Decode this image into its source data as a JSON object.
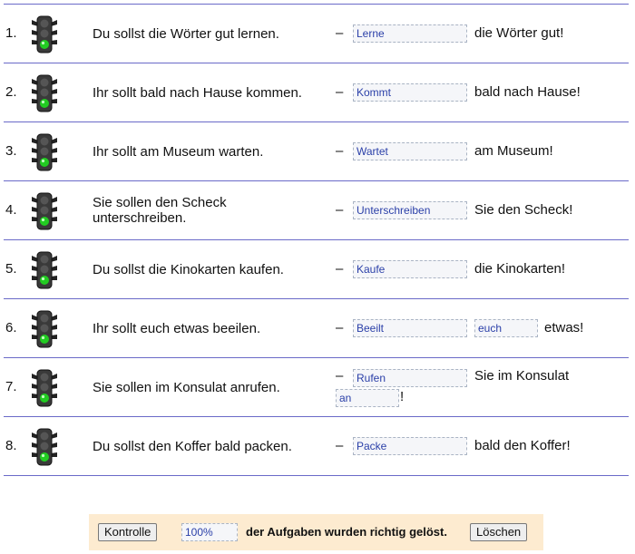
{
  "exercise": {
    "rows": [
      {
        "number": "1.",
        "prompt": "Du sollst die Wörter gut lernen.",
        "dash": "–",
        "answer1": "Lerne",
        "after1": "die Wörter gut!"
      },
      {
        "number": "2.",
        "prompt": "Ihr sollt bald nach Hause kommen.",
        "dash": "–",
        "answer1": "Kommt",
        "after1": "bald nach Hause!"
      },
      {
        "number": "3.",
        "prompt": "Ihr sollt am Museum warten.",
        "dash": "–",
        "answer1": "Wartet",
        "after1": "am Museum!"
      },
      {
        "number": "4.",
        "prompt": "Sie sollen den Scheck unterschreiben.",
        "dash": "–",
        "answer1": "Unterschreiben",
        "after1": "Sie den Scheck!"
      },
      {
        "number": "5.",
        "prompt": "Du sollst die Kinokarten kaufen.",
        "dash": "–",
        "answer1": "Kaufe",
        "after1": "die Kinokarten!"
      },
      {
        "number": "6.",
        "prompt": "Ihr sollt euch etwas beeilen.",
        "dash": "–",
        "answer1": "Beeilt",
        "answer2": "euch",
        "after2": "etwas!"
      },
      {
        "number": "7.",
        "prompt": "Sie sollen im Konsulat anrufen.",
        "dash": "–",
        "answer1": "Rufen",
        "after1": "Sie im Konsulat",
        "answer2": "an",
        "after2": "!"
      },
      {
        "number": "8.",
        "prompt": "Du sollst den Koffer bald packen.",
        "dash": "–",
        "answer1": "Packe",
        "after1": "bald den Koffer!"
      }
    ]
  },
  "controls": {
    "check_label": "Kontrolle",
    "score_value": "100%",
    "score_text": "der Aufgaben wurden richtig gelöst.",
    "clear_label": "Löschen"
  },
  "colors": {
    "rule": "#6a6ac8",
    "input_text": "#2a3fa8",
    "control_bg": "#fdebd0",
    "light_green": "#22cc22"
  }
}
